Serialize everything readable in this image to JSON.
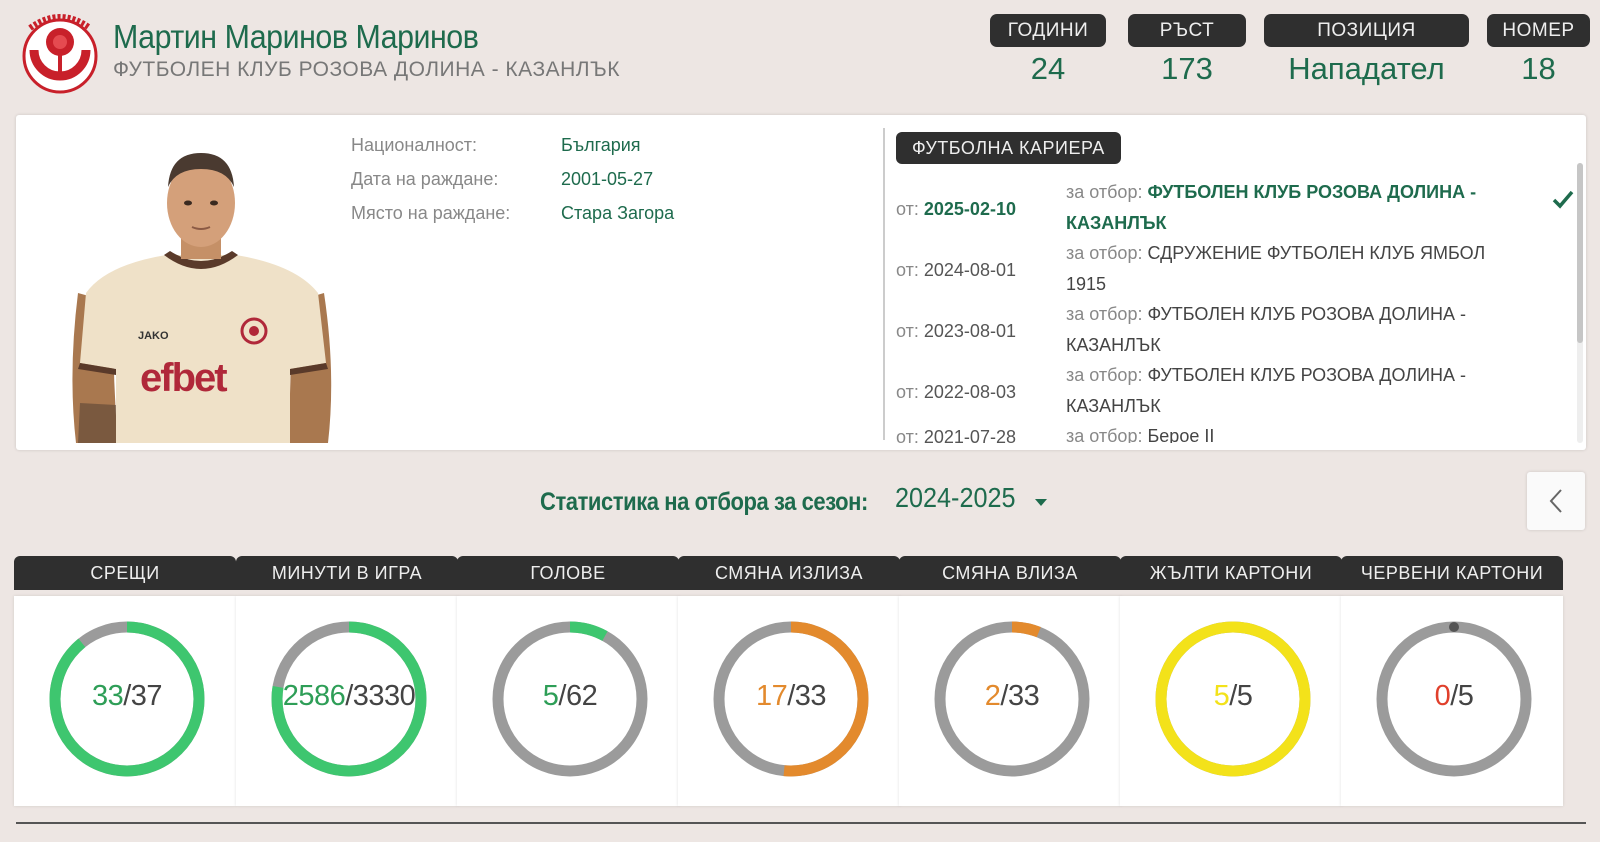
{
  "header": {
    "player_name": "Мартин Маринов Маринов",
    "club_name": "ФУТБОЛЕН КЛУБ РОЗОВА ДОЛИНА - КАЗАНЛЪК",
    "info": [
      {
        "label": "ГОДИНИ",
        "value": "24"
      },
      {
        "label": "РЪСТ",
        "value": "173"
      },
      {
        "label": "ПОЗИЦИЯ",
        "value": "Нападател"
      },
      {
        "label": "НОМЕР",
        "value": "18"
      }
    ]
  },
  "profile": {
    "details": [
      {
        "label": "Националност:",
        "value": "България"
      },
      {
        "label": "Дата на раждане:",
        "value": "2001-05-27"
      },
      {
        "label": "Място на раждане:",
        "value": "Стара Загора"
      }
    ],
    "career_label": "ФУТБОЛНА КАРИЕРА",
    "career_prefix_from": "от:",
    "career_prefix_team": "за отбор:",
    "career": [
      {
        "date": "2025-02-10",
        "team": "ФУТБОЛЕН КЛУБ РОЗОВА ДОЛИНА - КАЗАНЛЪК",
        "active": true
      },
      {
        "date": "2024-08-01",
        "team": "СДРУЖЕНИЕ ФУТБОЛЕН КЛУБ ЯМБОЛ 1915",
        "active": false
      },
      {
        "date": "2023-08-01",
        "team": "ФУТБОЛЕН КЛУБ РОЗОВА ДОЛИНА - КАЗАНЛЪК",
        "active": false
      },
      {
        "date": "2022-08-03",
        "team": "ФУТБОЛЕН КЛУБ РОЗОВА ДОЛИНА - КАЗАНЛЪК",
        "active": false
      },
      {
        "date": "2021-07-28",
        "team": "Берое II",
        "active": false
      }
    ]
  },
  "season": {
    "label": "Статистика на отбора за сезон:",
    "value": "2024-2025"
  },
  "stats": [
    {
      "label": "СРЕЩИ",
      "value": "33",
      "total": "37",
      "color": "#3ec66f",
      "value_color": "#2e9e57"
    },
    {
      "label": "МИНУТИ В ИГРА",
      "value": "2586",
      "total": "3330",
      "color": "#3ec66f",
      "value_color": "#2e9e57"
    },
    {
      "label": "ГОЛОВЕ",
      "value": "5",
      "total": "62",
      "color": "#3ec66f",
      "value_color": "#2e9e57"
    },
    {
      "label": "СМЯНА ИЗЛИЗА",
      "value": "17",
      "total": "33",
      "color": "#e38a2d",
      "value_color": "#e38a2d"
    },
    {
      "label": "СМЯНА ВЛИЗА",
      "value": "2",
      "total": "33",
      "color": "#e38a2d",
      "value_color": "#e38a2d"
    },
    {
      "label": "ЖЪЛТИ КАРТОНИ",
      "value": "5",
      "total": "5",
      "color": "#f3e21a",
      "value_color": "#f3e21a"
    },
    {
      "label": "ЧЕРВЕНИ КАРТОНИ",
      "value": "0",
      "total": "5",
      "color": "#e0402c",
      "value_color": "#e0402c"
    }
  ],
  "colors": {
    "accent_green": "#1e6b4d",
    "dark_label": "#2f2f2f",
    "ring_gray": "#9b9b9b"
  }
}
